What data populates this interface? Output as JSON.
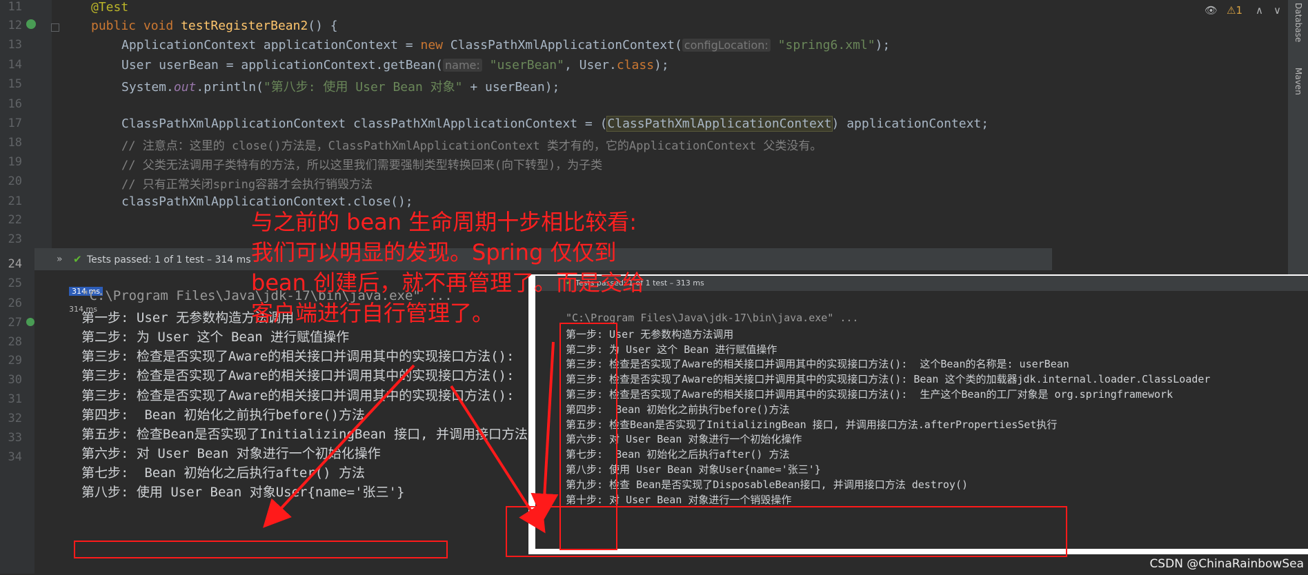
{
  "editor": {
    "line_numbers": [
      "11",
      "12",
      "13",
      "14",
      "15",
      "16",
      "17",
      "18",
      "19",
      "20",
      "21",
      "22",
      "23",
      "24",
      "25",
      "26",
      "27",
      "28",
      "29",
      "30",
      "31",
      "32",
      "33",
      "34"
    ],
    "annotation": "@Test",
    "method_decl": {
      "kw": "public void",
      "name": "testRegisterBean2",
      "rest": "() {"
    },
    "line13": {
      "a": "ApplicationContext applicationContext = ",
      "new": "new",
      "b": " ClassPathXmlApplicationContext(",
      "hint": "configLocation:",
      "str": "\"spring6.xml\"",
      "c": ");"
    },
    "line14": {
      "a": "User userBean = applicationContext.getBean(",
      "hint": "name:",
      "str": "\"userBean\"",
      "b": ", User.",
      "cls": "class",
      "c": ");"
    },
    "line15": {
      "a": "System.",
      "out": "out",
      "b": ".println(",
      "str": "\"第八步: 使用 User Bean 对象\"",
      "c": " + userBean);"
    },
    "line17": {
      "a": "ClassPathXmlApplicationContext classPathXmlApplicationContext = (",
      "hl": "ClassPathXmlApplicationContext",
      "b": ") applicationContext;"
    },
    "line18": "// 注意点：这里的 close()方法是，ClassPathXmlApplicationContext 类才有的，它的ApplicationContext 父类没有。",
    "line19": "// 父类无法调用子类特有的方法，所以这里我们需要强制类型转换回来(向下转型)，为子类",
    "line20": "// 只有正常关闭spring容器才会执行销毁方法",
    "line21": "classPathXmlApplicationContext.close();",
    "line22": "}",
    "widgets": {
      "eye": "👁",
      "count": "⚠1",
      "up": "∧",
      "down": "∨"
    }
  },
  "right_strip": {
    "database": "Database",
    "maven": "Maven"
  },
  "run_panel": {
    "status": "Tests passed: 1 of 1 test – 314 ms",
    "times": [
      "314 ms",
      "314 ms"
    ],
    "lines": [
      "\"C:\\Program Files\\Java\\jdk-17\\bin\\java.exe\" ...",
      "第一步: User 无参数构造方法调用",
      "第二步: 为 User 这个 Bean 进行赋值操作",
      "第三步: 检查是否实现了Aware的相关接口并调用其中的实现接口方法():",
      "第三步: 检查是否实现了Aware的相关接口并调用其中的实现接口方法():",
      "第三步: 检查是否实现了Aware的相关接口并调用其中的实现接口方法():",
      "第四步:  Bean 初始化之前执行before()方法",
      "第五步: 检查Bean是否实现了InitializingBean 接口, 并调用接口方法",
      "第六步: 对 User Bean 对象进行一个初始化操作",
      "第七步:  Bean 初始化之后执行after() 方法",
      "第八步: 使用 User Bean 对象User{name='张三'}"
    ]
  },
  "overlay_screenshot": {
    "status": "Tests passed: 1 of 1 test – 313 ms",
    "lines": [
      "\"C:\\Program Files\\Java\\jdk-17\\bin\\java.exe\" ...",
      "第一步: User 无参数构造方法调用",
      "第二步: 为 User 这个 Bean 进行赋值操作",
      "第三步: 检查是否实现了Aware的相关接口并调用其中的实现接口方法():  这个Bean的名称是: userBean",
      "第三步: 检查是否实现了Aware的相关接口并调用其中的实现接口方法(): Bean 这个类的加载器jdk.internal.loader.ClassLoader",
      "第三步: 检查是否实现了Aware的相关接口并调用其中的实现接口方法():  生产这个Bean的工厂对象是 org.springframework",
      "第四步:  Bean 初始化之前执行before()方法",
      "第五步: 检查Bean是否实现了InitializingBean 接口, 并调用接口方法.afterPropertiesSet执行",
      "第六步: 对 User Bean 对象进行一个初始化操作",
      "第七步:  Bean 初始化之后执行after() 方法",
      "第八步: 使用 User Bean 对象User{name='张三'}",
      "第九步: 检查 Bean是否实现了DisposableBean接口, 并调用接口方法 destroy()",
      "第十步: 对 User Bean 对象进行一个销毁操作"
    ]
  },
  "annotation_note": [
    "与之前的 bean 生命周期十步相比较看:",
    "我们可以明显的发现。Spring 仅仅到",
    "bean 创建后，就不再管理了。而是交给",
    "客户端进行自行管理了。"
  ],
  "colors": {
    "annotation_red": "#ff2020",
    "editor_bg": "#2b2b2b",
    "pass_green": "#5fb832"
  },
  "watermark": "CSDN @ChinaRainbowSea"
}
